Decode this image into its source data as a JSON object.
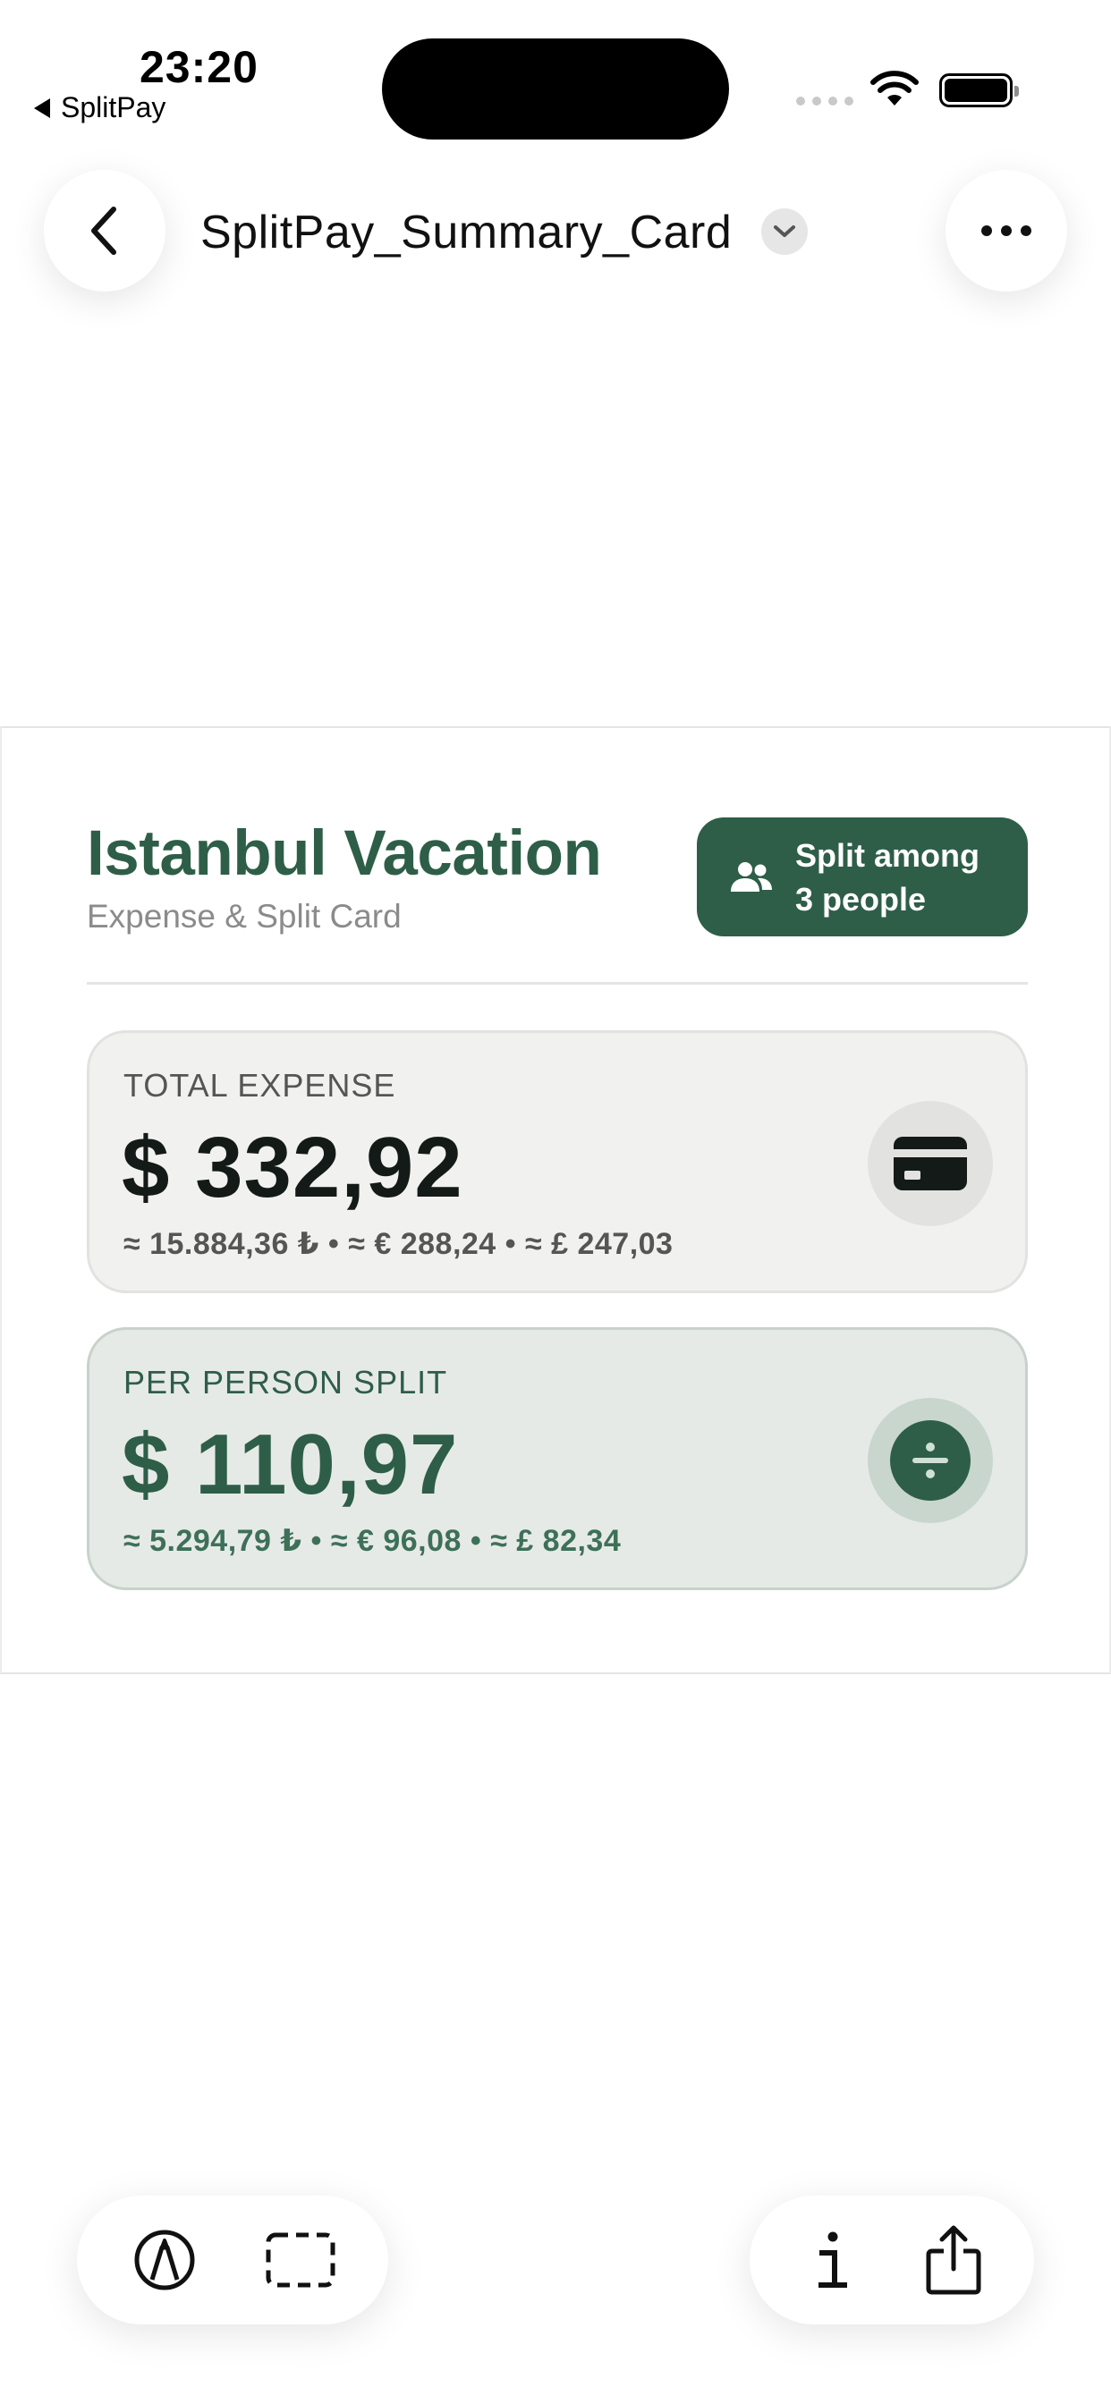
{
  "status_bar": {
    "time": "23:20",
    "back_app": "SplitPay"
  },
  "header": {
    "title": "SplitPay_Summary_Card",
    "back_icon": "chevron-left-icon",
    "dropdown_icon": "chevron-down-icon",
    "more_icon": "more-horizontal-icon"
  },
  "card": {
    "title": "Istanbul Vacation",
    "subtitle": "Expense & Split Card",
    "split_badge": {
      "line1": "Split among",
      "line2": "3 people",
      "icon": "people-icon"
    },
    "total": {
      "label": "TOTAL EXPENSE",
      "amount": "$ 332,92",
      "conversions": "≈ 15.884,36 ₺  •  ≈ € 288,24  •  ≈ £ 247,03",
      "icon": "credit-card-icon"
    },
    "per_person": {
      "label": "PER PERSON SPLIT",
      "amount": "$ 110,97",
      "conversions": "≈ 5.294,79 ₺  •  ≈ € 96,08  •  ≈ £ 82,34",
      "icon": "divide-icon"
    }
  },
  "toolbar": {
    "markup_icon": "markup-pen-icon",
    "select_icon": "selection-rect-icon",
    "info_icon": "info-icon",
    "share_icon": "share-icon"
  },
  "colors": {
    "accent": "#2e5e48",
    "total_panel_bg": "#f1f2f0",
    "per_person_panel_bg": "#e6eae7"
  }
}
